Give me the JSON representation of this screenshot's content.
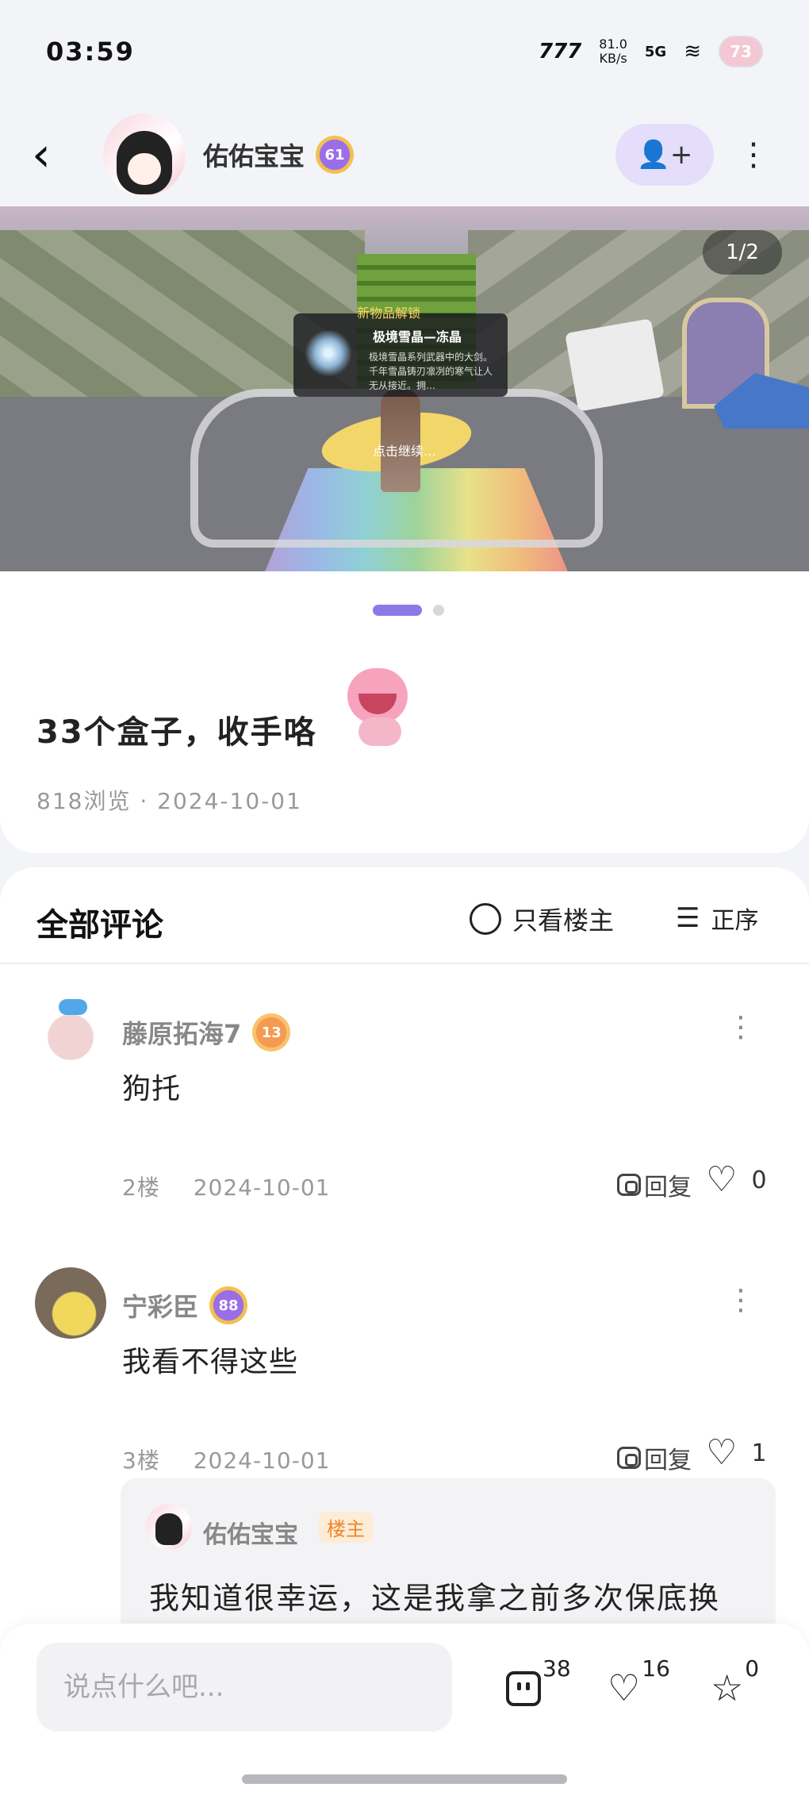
{
  "status_bar": {
    "time": "03:59",
    "brand": "777",
    "speed_value": "81.0",
    "speed_unit": "KB/s",
    "network": "5G",
    "wifi": "Wi-Fi",
    "battery": "73"
  },
  "header": {
    "back_icon": "chevron-left-icon",
    "username": "佑佑宝宝",
    "level": "61",
    "follow_icon": "add-user-icon",
    "more_icon": "more-vertical-icon"
  },
  "gallery": {
    "counter": "1/2",
    "current_index": 1,
    "total": 2,
    "popup_title": "新物品解锁",
    "popup_item": "极境雪晶—冻晶",
    "popup_desc": "极境雪晶系列武器中的大剑。千年雪晶铸刃凛冽的寒气让人无从接近。拥…",
    "tap_hint": "点击继续…"
  },
  "post": {
    "title": "33个盒子，收手咯",
    "meta": "818浏览 · 2024-10-01",
    "views": 818,
    "date": "2024-10-01"
  },
  "comments_header": {
    "title": "全部评论",
    "op_only_label": "只看楼主",
    "sort_label": "正序"
  },
  "comments": [
    {
      "name": "藤原拓海7",
      "level": "13",
      "text": "狗托",
      "floor": "2楼",
      "date": "2024-10-01",
      "reply_label": "回复",
      "likes": "0"
    },
    {
      "name": "宁彩臣",
      "level": "88",
      "text": "我看不得这些",
      "floor": "3楼",
      "date": "2024-10-01",
      "reply_label": "回复",
      "likes": "1",
      "reply": {
        "name": "佑佑宝宝",
        "tag": "楼主",
        "text": "我知道很幸运，这是我拿之前多次保底换"
      }
    }
  ],
  "bottom_bar": {
    "input_placeholder": "说点什么吧...",
    "comment_count": "38",
    "like_count": "16",
    "favorite_count": "0"
  },
  "colors": {
    "accent": "#8b79e8",
    "follow_bg": "#e4defa",
    "op_tag_text": "#f0852a",
    "op_tag_bg": "#fdecd6"
  }
}
